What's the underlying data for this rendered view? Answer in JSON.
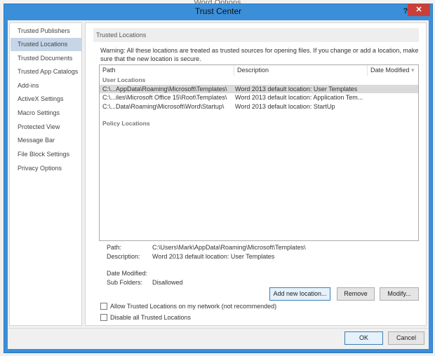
{
  "background_window": {
    "title": "Word Options"
  },
  "dialog": {
    "title": "Trust Center",
    "help_label": "?",
    "close_label": "✕"
  },
  "sidebar": {
    "items": [
      {
        "label": "Trusted Publishers",
        "selected": false
      },
      {
        "label": "Trusted Locations",
        "selected": true
      },
      {
        "label": "Trusted Documents",
        "selected": false
      },
      {
        "label": "Trusted App Catalogs",
        "selected": false
      },
      {
        "label": "Add-ins",
        "selected": false
      },
      {
        "label": "ActiveX Settings",
        "selected": false
      },
      {
        "label": "Macro Settings",
        "selected": false
      },
      {
        "label": "Protected View",
        "selected": false
      },
      {
        "label": "Message Bar",
        "selected": false
      },
      {
        "label": "File Block Settings",
        "selected": false
      },
      {
        "label": "Privacy Options",
        "selected": false
      }
    ]
  },
  "main": {
    "section_title": "Trusted Locations",
    "warning_line1": "Warning: All these locations are treated as trusted sources for opening files.  If you change or add a location, make",
    "warning_line2": "sure that the new location is secure.",
    "table": {
      "columns": [
        "Path",
        "Description",
        "Date Modified"
      ],
      "sort_icon": "▾",
      "user_group": "User Locations",
      "rows": [
        {
          "path": "C:\\...AppData\\Roaming\\Microsoft\\Templates\\",
          "description": "Word 2013 default location: User Templates"
        },
        {
          "path": "C:\\...iles\\Microsoft Office 15\\Root\\Templates\\",
          "description": "Word 2013 default location: Application Tem..."
        },
        {
          "path": "C:\\...Data\\Roaming\\Microsoft\\Word\\Startup\\",
          "description": "Word 2013 default location: StartUp"
        }
      ],
      "policy_group": "Policy Locations"
    },
    "details": {
      "path_label": "Path:",
      "path_value": "C:\\Users\\Mark\\AppData\\Roaming\\Microsoft\\Templates\\",
      "description_label": "Description:",
      "description_value": "Word 2013 default location: User Templates",
      "date_label": "Date Modified:",
      "subfolders_label": "Sub Folders:",
      "subfolders_value": "Disallowed"
    },
    "buttons": {
      "add": "Add new location...",
      "remove": "Remove",
      "modify": "Modify..."
    },
    "checkboxes": [
      {
        "label": "Allow Trusted Locations on my network (not recommended)",
        "checked": false
      },
      {
        "label": "Disable all Trusted Locations",
        "checked": false
      }
    ]
  },
  "footer": {
    "ok": "OK",
    "cancel": "Cancel"
  }
}
